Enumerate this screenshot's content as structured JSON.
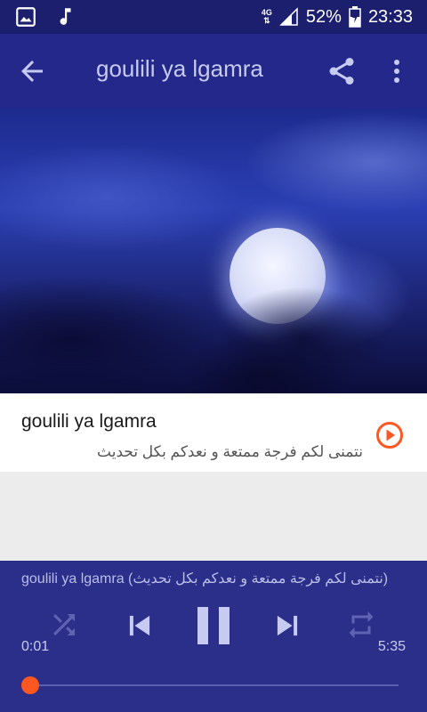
{
  "status_bar": {
    "network": "4G",
    "battery": "52%",
    "time": "23:33",
    "icons": [
      "image-icon",
      "music-note-icon",
      "signal-icon",
      "battery-icon"
    ]
  },
  "app_bar": {
    "title": "goulili ya lgamra",
    "icons": [
      "back-arrow-icon",
      "share-icon",
      "more-vert-icon"
    ]
  },
  "track": {
    "title": "goulili ya lgamra",
    "subtitle": "نتمنى لكم فرجة ممتعة و نعدكم بكل تحديث"
  },
  "player": {
    "now_playing": "goulili ya lgamra (نتمنى لكم فرجة ممتعة و نعدكم بكل تحديث)",
    "current_time": "0:01",
    "total_time": "5:35",
    "progress": 0.003,
    "icons": [
      "shuffle-icon",
      "skip-previous-icon",
      "pause-icon",
      "skip-next-icon",
      "repeat-icon"
    ]
  },
  "colors": {
    "status_bar": "#1b1f6e",
    "app_bar": "#23288a",
    "player": "#2c2f8a",
    "accent": "#ff5722"
  }
}
